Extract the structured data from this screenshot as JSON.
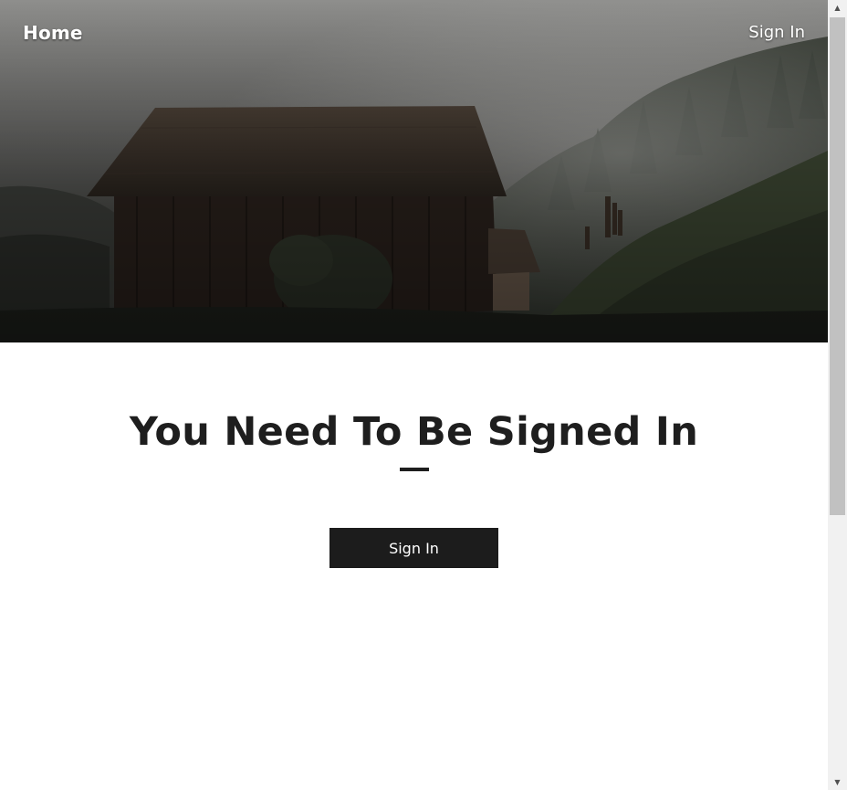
{
  "nav": {
    "home_label": "Home",
    "signin_label": "Sign In"
  },
  "hero": {
    "image_icon": "misty-barn-landscape-image"
  },
  "main": {
    "title": "You Need To Be Signed In",
    "button_label": "Sign In"
  },
  "colors": {
    "text_dark": "#1e1e1e",
    "button_bg": "#1c1c1c",
    "nav_text": "#ffffff"
  },
  "scrollbar": {
    "up_icon": "scroll-up-arrow-icon",
    "down_icon": "scroll-down-arrow-icon"
  }
}
